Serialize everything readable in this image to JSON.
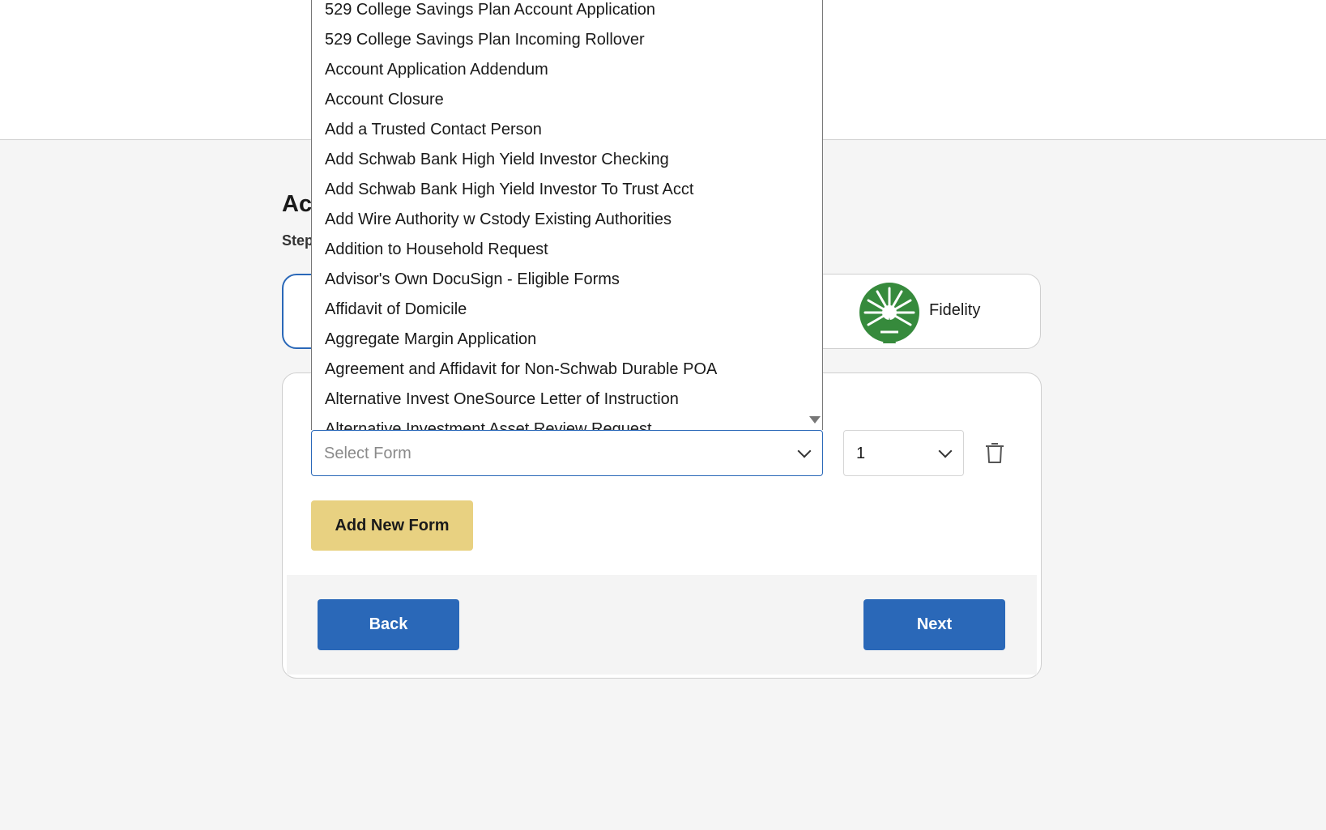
{
  "page": {
    "title_partial": "Ac",
    "step_partial": "Step"
  },
  "custodians": [
    {
      "name": "",
      "selected": true
    },
    {
      "name": "Fidelity",
      "selected": false,
      "icon": "fidelity-logo-icon",
      "color": "#368a3c"
    }
  ],
  "form_row": {
    "select_placeholder": "Select Form",
    "quantity_value": "1"
  },
  "dropdown": {
    "options": [
      "529 College Savings Plan Account Application",
      "529 College Savings Plan Incoming Rollover",
      "Account Application Addendum",
      "Account Closure",
      "Add a Trusted Contact Person",
      "Add Schwab Bank High Yield Investor Checking",
      "Add Schwab Bank High Yield Investor To Trust Acct",
      "Add Wire Authority w Cstody Existing Authorities",
      "Addition to Household Request",
      "Advisor's Own DocuSign - Eligible Forms",
      "Affidavit of Domicile",
      "Aggregate Margin Application",
      "Agreement and Affidavit for Non-Schwab Durable POA",
      "Alternative Invest OneSource Letter of Instruction",
      "Alternative Investment Asset Review Request"
    ]
  },
  "buttons": {
    "add_new_form": "Add New Form",
    "back": "Back",
    "next": "Next"
  },
  "colors": {
    "primary": "#2a68b8",
    "accent_gold": "#e8d181",
    "fidelity_green": "#368a3c"
  }
}
